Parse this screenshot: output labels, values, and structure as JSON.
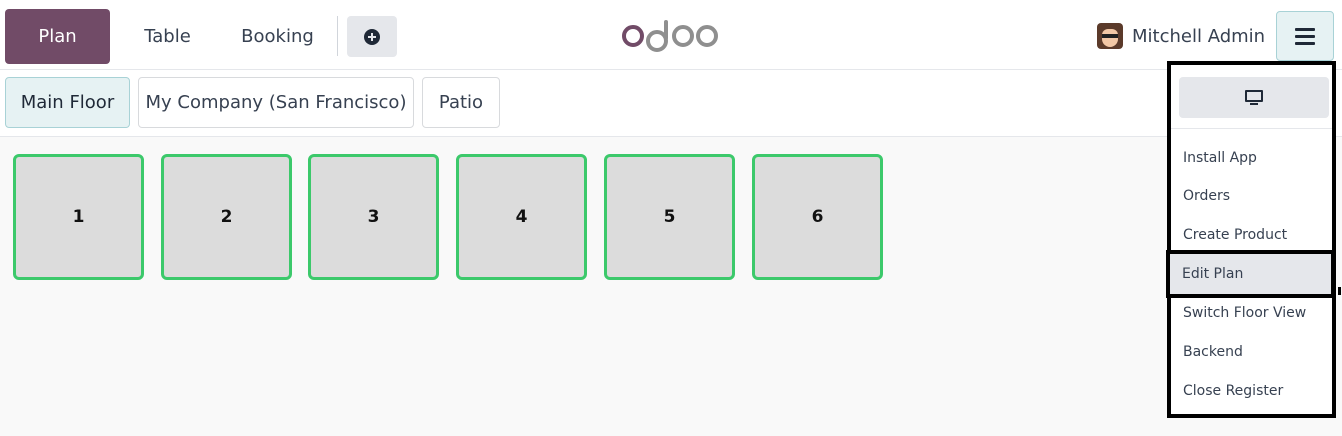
{
  "navbar": {
    "plan_label": "Plan",
    "table_label": "Table",
    "booking_label": "Booking",
    "add_icon": "plus-circle-icon",
    "logo_text": "odoo",
    "user_name": "Mitchell Admin",
    "menu_icon": "hamburger-icon"
  },
  "floors": {
    "tabs": [
      {
        "label": "Main Floor",
        "active": true
      },
      {
        "label": "My Company (San Francisco)",
        "active": false
      },
      {
        "label": "Patio",
        "active": false
      }
    ]
  },
  "tables": [
    {
      "label": "1"
    },
    {
      "label": "2"
    },
    {
      "label": "3"
    },
    {
      "label": "4"
    },
    {
      "label": "5"
    },
    {
      "label": "6"
    }
  ],
  "menu": {
    "top_icon": "monitor-icon",
    "items": [
      {
        "label": "Install App"
      },
      {
        "label": "Orders"
      },
      {
        "label": "Create Product"
      },
      {
        "label": "Edit Plan",
        "highlighted": true
      },
      {
        "label": "Switch Floor View"
      },
      {
        "label": "Backend"
      },
      {
        "label": "Close Register"
      }
    ]
  },
  "colors": {
    "brand": "#714b67",
    "table_border": "#3cc96b",
    "table_fill": "#dcdcdc",
    "active_tab": "#e6f2f3"
  }
}
